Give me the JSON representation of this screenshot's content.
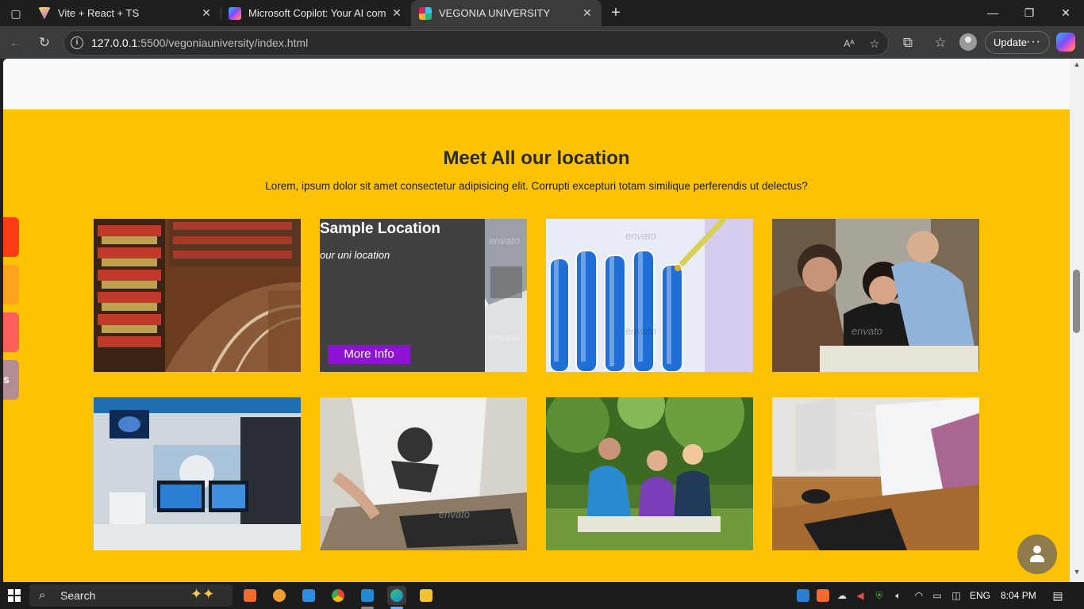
{
  "browser": {
    "tabs": [
      {
        "title": "Vite + React + TS",
        "favicon_color": "#a66bff"
      },
      {
        "title": "Microsoft Copilot: Your AI compa",
        "favicon_color": "#3aa0ff"
      },
      {
        "title": "VEGONIA UNIVERSITY",
        "favicon_color": "#e9473d"
      }
    ],
    "active_tab": 2,
    "new_tab_icon": "plus-icon",
    "url_host": "127.0.0.1",
    "url_rest": ":5500/vegoniauniversity/index.html",
    "update_label": "Update",
    "more_label": "···"
  },
  "page": {
    "section_title": "Meet All our location",
    "section_subtitle": "Lorem, ipsum dolor sit amet consectetur adipisicing elit. Corrupti excepturi totam similique perferendis ut delectus?",
    "overlay": {
      "title": "Sample Location",
      "subtitle": "our uni location",
      "button_label": "More Info",
      "button_color": "#8f13d4"
    },
    "gallery": [
      {
        "subject": "library-bookshelves"
      },
      {
        "subject": "laptop"
      },
      {
        "subject": "test-tubes"
      },
      {
        "subject": "students-studying"
      },
      {
        "subject": "medical-imaging-room"
      },
      {
        "subject": "student-drawing-tablet"
      },
      {
        "subject": "students-on-grass"
      },
      {
        "subject": "computer-lab"
      }
    ],
    "watermark": "envato",
    "side_tab_letter": "s",
    "accent_color": "#fdc203"
  },
  "taskbar": {
    "search_label": "Search",
    "language": "ENG",
    "time": "8:04 PM"
  }
}
